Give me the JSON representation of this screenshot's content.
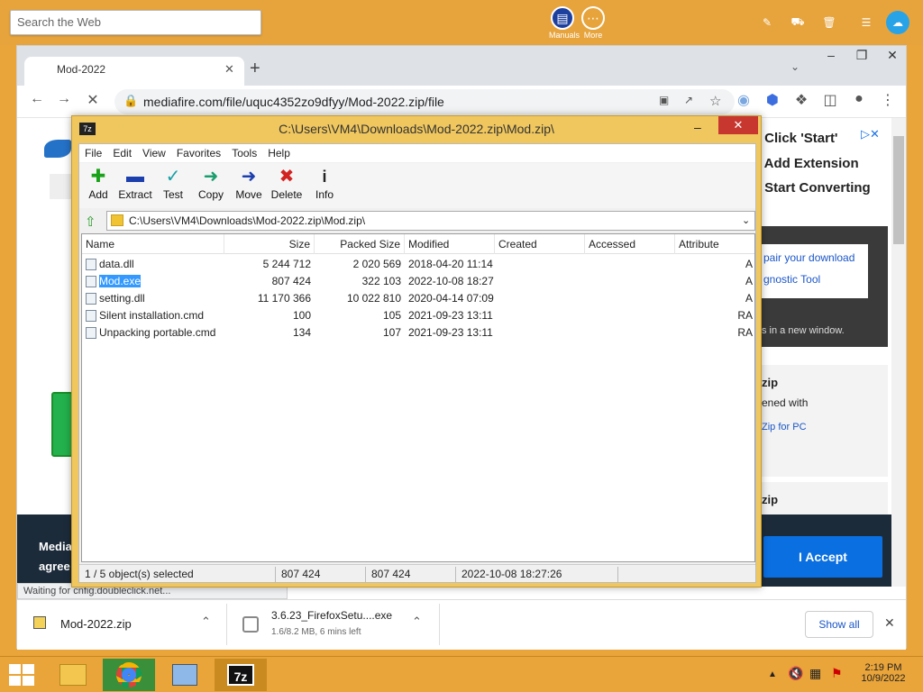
{
  "desktop": {
    "search_placeholder": "Search the Web",
    "manuals_label": "Manuals",
    "more_label": "More"
  },
  "browser": {
    "tab_title": "Mod-2022",
    "url": "mediafire.com/file/uquc4352zo9dfyy/Mod-2022.zip/file",
    "status_text": "Waiting for cnfig.doubleclick.net...",
    "ad_lines": [
      "Click 'Start'",
      "Add Extension",
      "Start Converting"
    ],
    "page_snips": {
      "repair": "pair your download",
      "diag": "gnostic Tool",
      "newwin": "s in a new window.",
      "zip1": "zip",
      "opened": "ened with",
      "forpc": "Zip for PC",
      "zip2": "zip",
      "media": "Media",
      "agree": "agree",
      "accept": "I Accept"
    },
    "downloads": [
      {
        "name": "Mod-2022.zip"
      },
      {
        "name": "3.6.23_FirefoxSetu....exe",
        "detail": "1.6/8.2 MB, 6 mins left"
      }
    ],
    "show_all": "Show all"
  },
  "sevenzip": {
    "title": "C:\\Users\\VM4\\Downloads\\Mod-2022.zip\\Mod.zip\\",
    "menu": [
      "File",
      "Edit",
      "View",
      "Favorites",
      "Tools",
      "Help"
    ],
    "tools": [
      "Add",
      "Extract",
      "Test",
      "Copy",
      "Move",
      "Delete",
      "Info"
    ],
    "address": "C:\\Users\\VM4\\Downloads\\Mod-2022.zip\\Mod.zip\\",
    "columns": [
      "Name",
      "Size",
      "Packed Size",
      "Modified",
      "Created",
      "Accessed",
      "Attribute"
    ],
    "files": [
      {
        "name": "data.dll",
        "size": "5 244 712",
        "packed": "2 020 569",
        "modified": "2018-04-20 11:14",
        "attr": "A"
      },
      {
        "name": "Mod.exe",
        "size": "807 424",
        "packed": "322 103",
        "modified": "2022-10-08 18:27",
        "attr": "A"
      },
      {
        "name": "setting.dll",
        "size": "11 170 366",
        "packed": "10 022 810",
        "modified": "2020-04-14 07:09",
        "attr": "A"
      },
      {
        "name": "Silent installation.cmd",
        "size": "100",
        "packed": "105",
        "modified": "2021-09-23 13:11",
        "attr": "RA"
      },
      {
        "name": "Unpacking portable.cmd",
        "size": "134",
        "packed": "107",
        "modified": "2021-09-23 13:11",
        "attr": "RA"
      }
    ],
    "status": {
      "selected": "1 / 5 object(s) selected",
      "size": "807 424",
      "packed": "807 424",
      "modified": "2022-10-08 18:27:26"
    }
  },
  "taskbar": {
    "time": "2:19 PM",
    "date": "10/9/2022"
  }
}
